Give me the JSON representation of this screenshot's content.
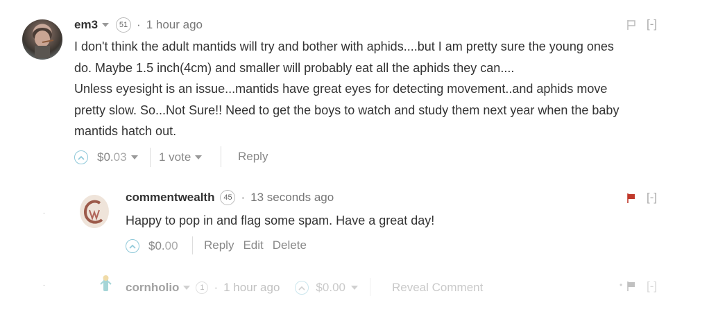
{
  "comments": [
    {
      "author": "em3",
      "reputation": "51",
      "dot": "·",
      "time": "1 hour ago",
      "body": [
        "I don't think the adult mantids will try and bother with aphids....but I am pretty sure the young ones",
        "do. Maybe 1.5 inch(4cm) and smaller will probably eat all the aphids they can....",
        "Unless eyesight is an issue...mantids have great eyes for detecting movement..and aphids move",
        "pretty slow. So...Not Sure!! Need to get the boys to watch and study them next year when the baby",
        "mantids hatch out."
      ],
      "payout_prefix": "$0.",
      "payout_suffix": "03",
      "votes": "1 vote",
      "reply": "Reply",
      "collapse": "[-]"
    },
    {
      "author": "commentwealth",
      "reputation": "45",
      "dot": "·",
      "time": "13 seconds ago",
      "body": "Happy to pop in and flag some spam. Have a great day!",
      "payout_prefix": "$0.",
      "payout_suffix": "00",
      "reply": "Reply",
      "edit": "Edit",
      "delete": "Delete",
      "collapse": "[-]",
      "flag_color": "#c0392b",
      "avatar_letter": "C"
    },
    {
      "author": "cornholio",
      "reputation": "1",
      "dot": "·",
      "time": "1 hour ago",
      "payout_prefix": "$0.",
      "payout_suffix": "00",
      "reveal": "Reveal Comment",
      "collapse": "[-]"
    }
  ],
  "colors": {
    "vote_accent": "#8ec8d9"
  }
}
